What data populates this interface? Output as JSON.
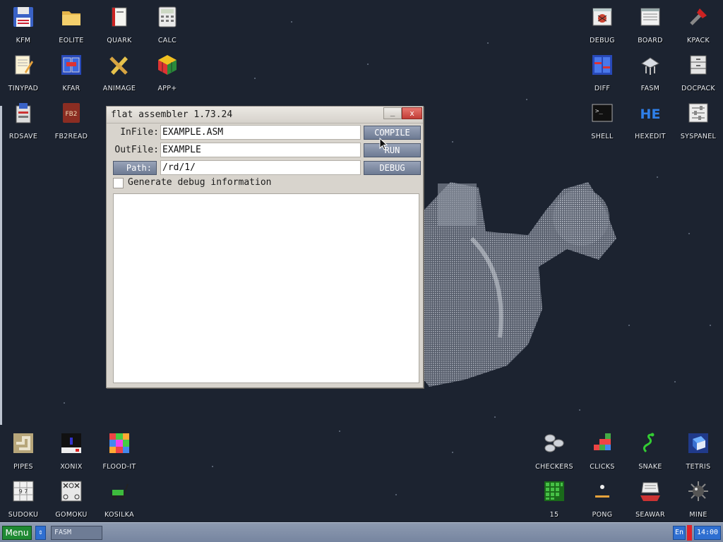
{
  "desktop_icons": {
    "kfm": "KFM",
    "eolite": "EOLITE",
    "quark": "QUARK",
    "calc": "CALC",
    "tinypad": "TINYPAD",
    "kfar": "KFAR",
    "animage": "ANIMAGE",
    "app_plus": "APP+",
    "rdsave": "RDSAVE",
    "fb2read": "FB2READ",
    "debug": "DEBUG",
    "board": "BOARD",
    "kpack": "KPACK",
    "diff": "DIFF",
    "fasm": "FASM",
    "docpack": "DOCPACK",
    "shell": "SHELL",
    "hexedit": "HEXEDIT",
    "syspanel": "SYSPANEL",
    "pipes": "PIPES",
    "xonix": "XONIX",
    "flood_it": "FLOOD-IT",
    "sudoku": "SUDOKU",
    "gomoku": "GOMOKU",
    "kosilka": "KOSILKA",
    "checkers": "CHECKERS",
    "clicks": "CLICKS",
    "snake": "SNAKE",
    "tetris": "TETRIS",
    "fifteen": "15",
    "pong": "PONG",
    "seawar": "SEAWAR",
    "mine": "MINE"
  },
  "icon_glyphs": {
    "sudoku_digits": "9 7\n 2",
    "hexedit_text": "HE",
    "shell_prompt": ">_",
    "fb2read_text": "FB2"
  },
  "window": {
    "title": "flat assembler 1.73.24",
    "minimize_label": "_",
    "close_label": "x",
    "infile_label": "InFile:",
    "infile_value": "EXAMPLE.ASM",
    "outfile_label": "OutFile:",
    "outfile_value": "EXAMPLE",
    "path_button_label": "Path:",
    "path_value": "/rd/1/",
    "compile_label": "COMPILE",
    "run_label": "RUN",
    "debug_label": "DEBUG",
    "debug_info_label": "Generate debug information",
    "debug_info_checked": false
  },
  "taskbar": {
    "menu_label": "Menu",
    "arrows_label": "⇕",
    "task_label": "FASM",
    "lang_label": "En",
    "clock": "14:00"
  },
  "colors": {
    "desktop_bg": "#1c2330",
    "taskbar": "#7f8da6",
    "button": "#7a87a0",
    "menu_green": "#1f8a33",
    "accent_blue": "#2f6fd1"
  }
}
